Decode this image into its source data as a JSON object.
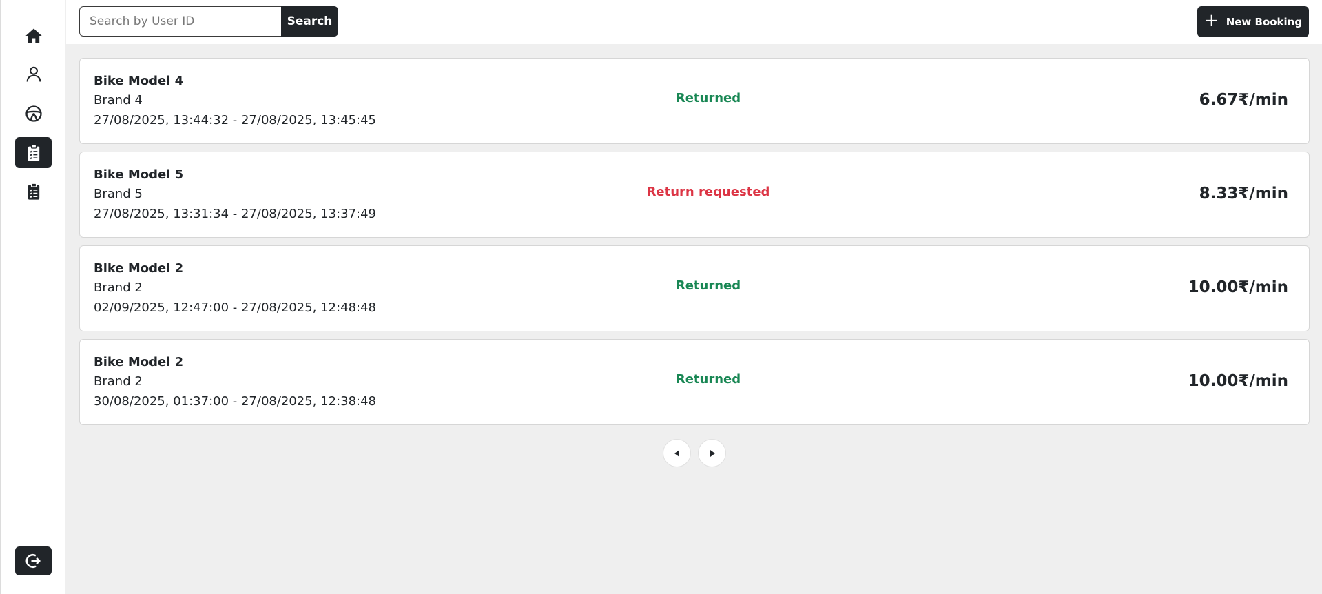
{
  "sidebar": {
    "items": [
      {
        "icon": "home-icon",
        "active": false
      },
      {
        "icon": "user-icon",
        "active": false
      },
      {
        "icon": "steering-wheel-icon",
        "active": false
      },
      {
        "icon": "clipboard-checklist-icon",
        "active": true
      },
      {
        "icon": "clipboard-checklist-icon",
        "active": false
      }
    ],
    "logout_icon": "logout-icon"
  },
  "search": {
    "placeholder": "Search by User ID",
    "value": "",
    "button_label": "Search"
  },
  "new_booking": {
    "icon": "plus-icon",
    "label": "New Booking"
  },
  "bookings": [
    {
      "model": "Bike Model 4",
      "brand": "Brand 4",
      "dates": "27/08/2025, 13:44:32 - 27/08/2025, 13:45:45",
      "status": "Returned",
      "price": "6.67₹/min"
    },
    {
      "model": "Bike Model 5",
      "brand": "Brand 5",
      "dates": "27/08/2025, 13:31:34 - 27/08/2025, 13:37:49",
      "status": "Return requested",
      "price": "8.33₹/min"
    },
    {
      "model": "Bike Model 2",
      "brand": "Brand 2",
      "dates": "02/09/2025, 12:47:00 - 27/08/2025, 12:48:48",
      "status": "Returned",
      "price": "10.00₹/min"
    },
    {
      "model": "Bike Model 2",
      "brand": "Brand 2",
      "dates": "30/08/2025, 01:37:00 - 27/08/2025, 12:38:48",
      "status": "Returned",
      "price": "10.00₹/min"
    }
  ],
  "pagination": {
    "prev_icon": "caret-left-icon",
    "next_icon": "caret-right-icon"
  },
  "colors": {
    "dark": "#212529",
    "status_returned": "#198754",
    "status_requested": "#dc3545",
    "background": "#efefef"
  }
}
